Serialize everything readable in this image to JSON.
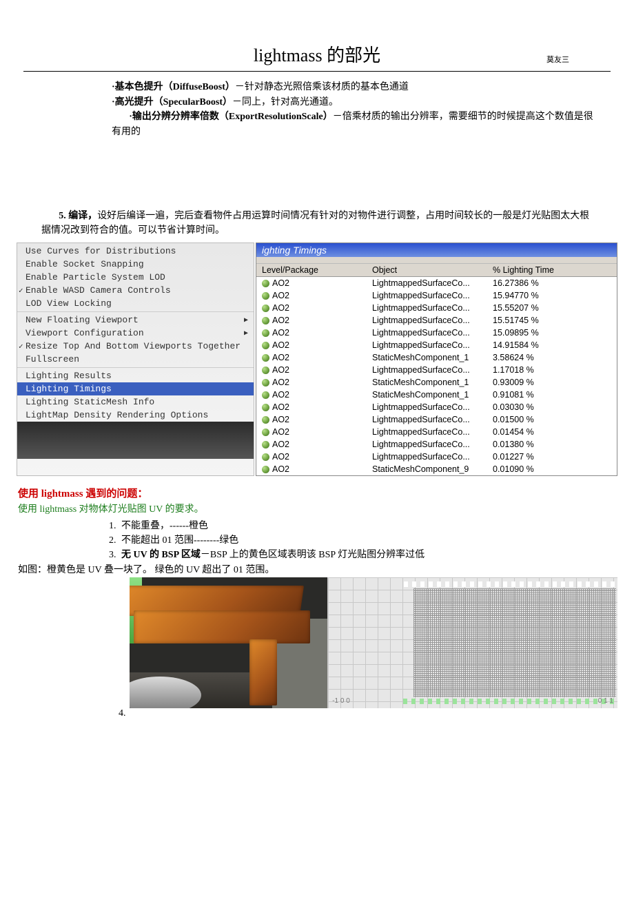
{
  "header": {
    "title": "lightmass 的部光",
    "author": "莫友三"
  },
  "bullets": {
    "b1_bold": "·基本色提升（DiffuseBoost）",
    "b1_rest": "－针对静态光照倍乘该材质的基本色通道",
    "b2_bold": "·高光提升（SpecularBoost）",
    "b2_rest": "－同上，针对高光通道。",
    "b3_bold": "·输出分辨分辨率倍数（ExportResolutionScale）",
    "b3_rest": "－倍乘材质的输出分辨率，需要细节的时候提高这个数值是很有用的"
  },
  "section5": {
    "lead_bold": "5. 编译，",
    "lead_rest": "设好后编译一遍，完后查看物件占用运算时间情况有针对的对物件进行调整，占用时间较长的一般是灯光贴图太大根据情况改到符合的值。可以节省计算时间。"
  },
  "menu": {
    "items": [
      {
        "label": "Use Curves for Distributions",
        "chk": false,
        "arrow": false
      },
      {
        "label": "Enable Socket Snapping",
        "chk": false,
        "arrow": false
      },
      {
        "label": "Enable Particle System LOD",
        "chk": false,
        "arrow": false
      },
      {
        "label": "Enable WASD Camera Controls",
        "chk": true,
        "arrow": false
      },
      {
        "label": "LOD View Locking",
        "chk": false,
        "arrow": false
      }
    ],
    "items2": [
      {
        "label": "New Floating Viewport",
        "chk": false,
        "arrow": true
      },
      {
        "label": "Viewport Configuration",
        "chk": false,
        "arrow": true
      },
      {
        "label": "Resize Top And Bottom Viewports Together",
        "chk": true,
        "arrow": false
      },
      {
        "label": "Fullscreen",
        "chk": false,
        "arrow": false
      }
    ],
    "items3": [
      {
        "label": "Lighting Results",
        "chk": false,
        "arrow": false,
        "sel": false
      },
      {
        "label": "Lighting Timings",
        "chk": false,
        "arrow": false,
        "sel": true
      },
      {
        "label": "Lighting StaticMesh Info",
        "chk": false,
        "arrow": false,
        "sel": false
      },
      {
        "label": "LightMap Density Rendering Options",
        "chk": false,
        "arrow": false,
        "sel": false
      }
    ]
  },
  "table": {
    "title": "ighting Timings",
    "headers": {
      "c1": "Level/Package",
      "c2": "Object",
      "c3": "% Lighting Time"
    },
    "rows": [
      {
        "c1": "AO2",
        "c2": "LightmappedSurfaceCo...",
        "c3": "16.27386 %"
      },
      {
        "c1": "AO2",
        "c2": "LightmappedSurfaceCo...",
        "c3": "15.94770 %"
      },
      {
        "c1": "AO2",
        "c2": "LightmappedSurfaceCo...",
        "c3": "15.55207 %"
      },
      {
        "c1": "AO2",
        "c2": "LightmappedSurfaceCo...",
        "c3": "15.51745 %"
      },
      {
        "c1": "AO2",
        "c2": "LightmappedSurfaceCo...",
        "c3": "15.09895 %"
      },
      {
        "c1": "AO2",
        "c2": "LightmappedSurfaceCo...",
        "c3": "14.91584 %"
      },
      {
        "c1": "AO2",
        "c2": "StaticMeshComponent_1",
        "c3": "3.58624 %"
      },
      {
        "c1": "AO2",
        "c2": "LightmappedSurfaceCo...",
        "c3": "1.17018 %"
      },
      {
        "c1": "AO2",
        "c2": "StaticMeshComponent_1",
        "c3": "0.93009 %"
      },
      {
        "c1": "AO2",
        "c2": "StaticMeshComponent_1",
        "c3": "0.91081 %"
      },
      {
        "c1": "AO2",
        "c2": "LightmappedSurfaceCo...",
        "c3": "0.03030 %"
      },
      {
        "c1": "AO2",
        "c2": "LightmappedSurfaceCo...",
        "c3": "0.01500 %"
      },
      {
        "c1": "AO2",
        "c2": "LightmappedSurfaceCo...",
        "c3": "0.01454 %"
      },
      {
        "c1": "AO2",
        "c2": "LightmappedSurfaceCo...",
        "c3": "0.01380 %"
      },
      {
        "c1": "AO2",
        "c2": "LightmappedSurfaceCo...",
        "c3": "0.01227 %"
      },
      {
        "c1": "AO2",
        "c2": "StaticMeshComponent_9",
        "c3": "0.01090 %"
      }
    ]
  },
  "problems": {
    "heading": "使用 lightmass 遇到的问题：",
    "sub": "使用 lightmass 对物体灯光贴图 UV 的要求。",
    "li1": "不能重叠，------橙色",
    "li2": "不能超出 01 范围--------绿色",
    "li3_bold": "无 UV 的 BSP 区域",
    "li3_rest": "－BSP 上的黄色区域表明该 BSP 灯光贴图分辨率过低",
    "caption": "如图：橙黄色是 UV 叠一块了。  绿色的 UV 超出了 01 范围。",
    "num4": "4."
  },
  "uvlabels": {
    "left": "-1 0  0",
    "right": "0  1  1"
  }
}
